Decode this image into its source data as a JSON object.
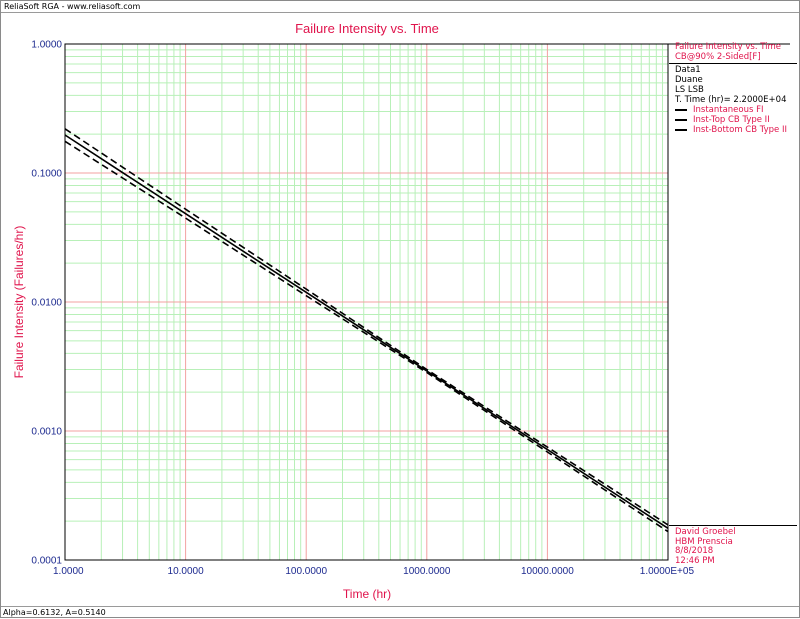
{
  "window": {
    "header_text": "ReliaSoft RGA - www.reliasoft.com",
    "status_text": "Alpha=0.6132, A=0.5140"
  },
  "colors": {
    "title": "#e0144c",
    "tick_label": "#1d2a8f",
    "major_grid": "#f3a0a0",
    "minor_grid": "#b8f0b8",
    "curve": "#000000"
  },
  "legend": {
    "title": "Failure Intensity vs. Time",
    "cb_label": "CB@90% 2-Sided[F]",
    "data_name": "Data1",
    "user": "Duane",
    "method": "LS LSB",
    "total_time": "T. Time (hr)= 2.2000E+04",
    "items": [
      {
        "label": "Instantaneous FI",
        "style": "solid"
      },
      {
        "label": "Inst-Top CB Type II",
        "style": "dashed"
      },
      {
        "label": "Inst-Bottom CB Type II",
        "style": "dashed"
      }
    ]
  },
  "footer": {
    "author": "David Groebel",
    "company": "HBM Prenscia",
    "date": "8/8/2018",
    "time": "12:46 PM"
  },
  "chart_data": {
    "type": "line",
    "title": "Failure Intensity vs. Time",
    "xlabel": "Time (hr)",
    "ylabel": "Failure Intensity (Failures/hr)",
    "xscale": "log",
    "yscale": "log",
    "xlim": [
      1,
      100000
    ],
    "ylim": [
      0.0001,
      1
    ],
    "grid": true,
    "legend_position": "right",
    "x_ticks": [
      {
        "value": 1,
        "label": "1.0000"
      },
      {
        "value": 10,
        "label": "10.0000"
      },
      {
        "value": 100,
        "label": "100.0000"
      },
      {
        "value": 1000,
        "label": "1000.0000"
      },
      {
        "value": 10000,
        "label": "10000.0000"
      },
      {
        "value": 100000,
        "label": "1.0000E+05"
      }
    ],
    "y_ticks": [
      {
        "value": 1,
        "label": "1.0000"
      },
      {
        "value": 0.1,
        "label": "0.1000"
      },
      {
        "value": 0.01,
        "label": "0.0100"
      },
      {
        "value": 0.001,
        "label": "0.0010"
      },
      {
        "value": 0.0001,
        "label": "0.0001"
      }
    ],
    "series": [
      {
        "name": "Instantaneous FI",
        "style": "solid",
        "x": [
          1,
          10,
          100,
          1000,
          10000,
          100000
        ],
        "y": [
          0.197,
          0.0484,
          0.0119,
          0.00292,
          0.000718,
          0.000176
        ]
      },
      {
        "name": "Inst-Top CB Type II",
        "style": "dashed",
        "x": [
          1,
          10,
          100,
          1000,
          10000,
          100000
        ],
        "y": [
          0.22,
          0.0524,
          0.0126,
          0.003,
          0.00075,
          0.000187
        ]
      },
      {
        "name": "Inst-Bottom CB Type II",
        "style": "dashed",
        "x": [
          1,
          10,
          100,
          1000,
          10000,
          100000
        ],
        "y": [
          0.176,
          0.0447,
          0.0112,
          0.00284,
          0.000687,
          0.000166
        ]
      }
    ]
  }
}
